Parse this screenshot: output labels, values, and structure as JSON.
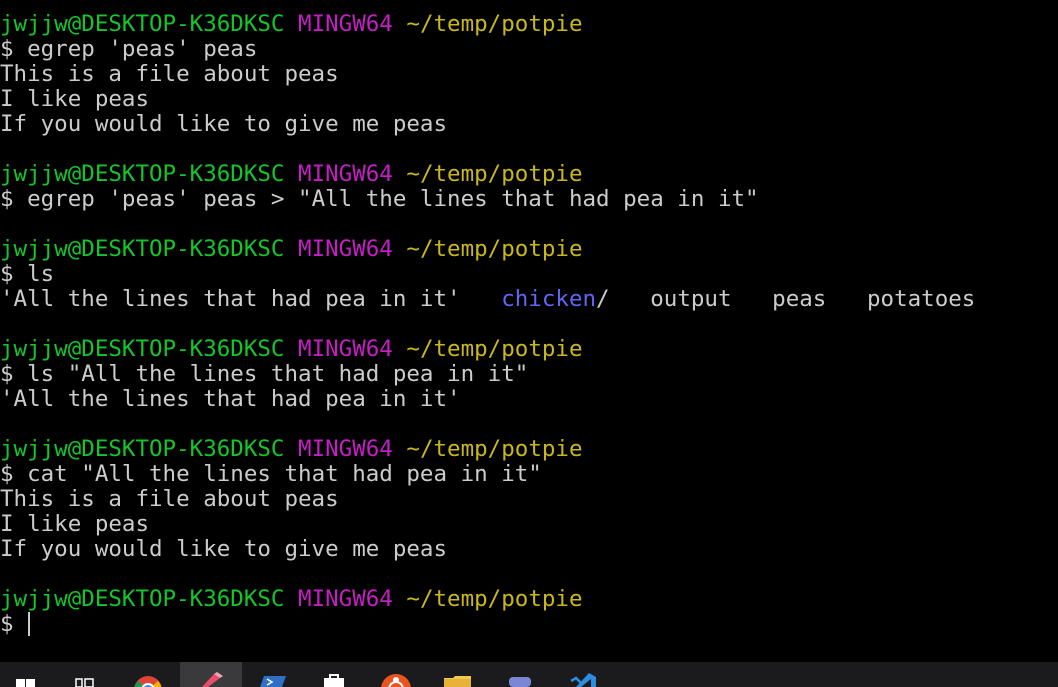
{
  "terminal": {
    "prompt": {
      "user_host": "jwjjw@DESKTOP-K36DKSC",
      "shell": "MINGW64",
      "path": "~/temp/potpie",
      "symbol": "$ "
    },
    "lines": [
      "egrep 'peas' peas",
      "This is a file about peas",
      "I like peas",
      "If you would like to give me peas",
      "egrep 'peas' peas > \"All the lines that had pea in it\"",
      "ls",
      "'All the lines that had pea in it'",
      "chicken",
      "/",
      "output",
      "peas",
      "potatoes",
      "ls \"All the lines that had pea in it\"",
      "'All the lines that had pea in it'",
      "cat \"All the lines that had pea in it\"",
      "This is a file about peas",
      "I like peas",
      "If you would like to give me peas"
    ]
  },
  "colors": {
    "background": "#000000",
    "text": "#cccccc",
    "user_host": "#13c62a",
    "shell": "#c41ec4",
    "path": "#c9b81b",
    "directory": "#6264f2",
    "taskbar": "#1b1b1d"
  },
  "taskbar": {
    "icons": [
      "windows-start-icon",
      "task-view-icon",
      "chrome-icon",
      "pen-tool-icon",
      "powershell-icon",
      "store-icon",
      "ubuntu-icon",
      "file-explorer-icon",
      "discord-icon",
      "vscode-icon"
    ]
  }
}
